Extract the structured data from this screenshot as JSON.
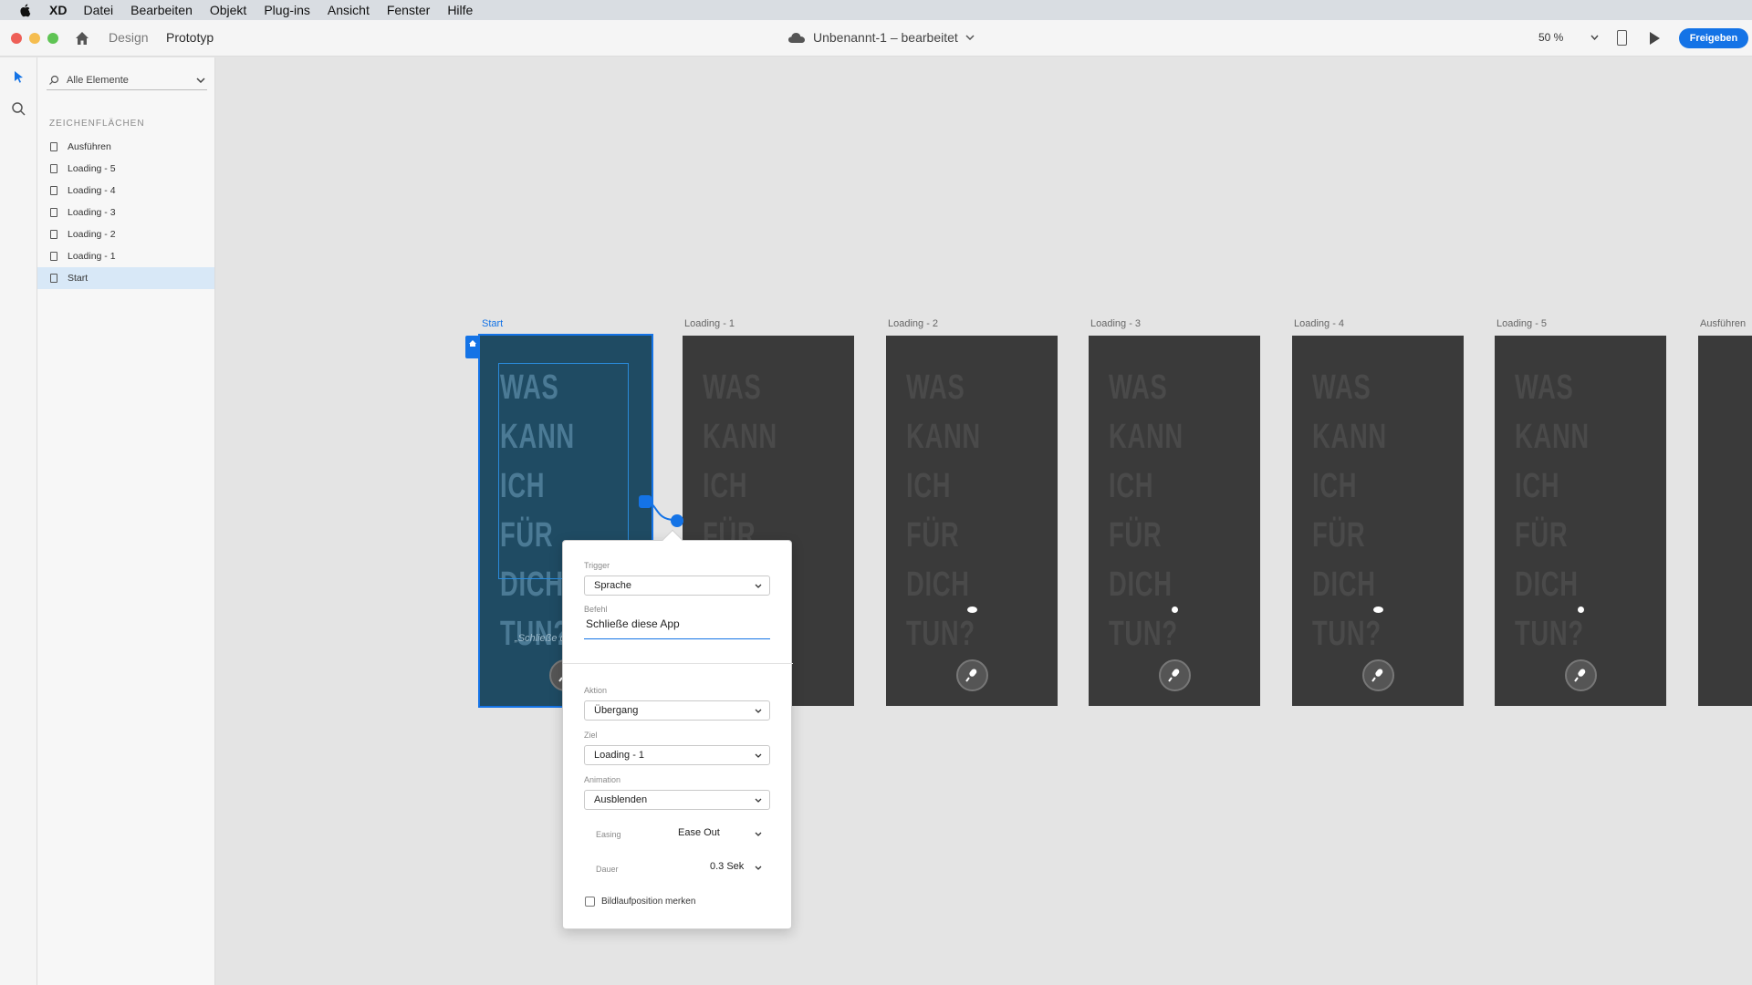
{
  "menubar": {
    "app": "XD",
    "items": [
      "Datei",
      "Bearbeiten",
      "Objekt",
      "Plug-ins",
      "Ansicht",
      "Fenster",
      "Hilfe"
    ]
  },
  "toolbar": {
    "tab_design": "Design",
    "tab_prototype": "Prototyp",
    "doc_title": "Unbenannt-1 – bearbeitet",
    "zoom": "50 %",
    "share": "Freigeben"
  },
  "layers": {
    "search_placeholder": "Alle Elemente",
    "section_title": "ZEICHENFLÄCHEN",
    "items": [
      "Ausführen",
      "Loading - 5",
      "Loading - 4",
      "Loading - 3",
      "Loading - 2",
      "Loading - 1",
      "Start"
    ],
    "selected": "Start"
  },
  "artboards": {
    "labels": [
      "Start",
      "Loading - 1",
      "Loading - 2",
      "Loading - 3",
      "Loading - 4",
      "Loading - 5",
      "Ausführen"
    ],
    "headline": "WAS\nKANN ICH\nFÜR DICH\nTUN?",
    "start_quote": "„Schließe d"
  },
  "interaction": {
    "trigger_label": "Trigger",
    "trigger_value": "Sprache",
    "command_label": "Befehl",
    "command_value": "Schließe diese App",
    "action_label": "Aktion",
    "action_value": "Übergang",
    "target_label": "Ziel",
    "target_value": "Loading - 1",
    "animation_label": "Animation",
    "animation_value": "Ausblenden",
    "easing_label": "Easing",
    "easing_value": "Ease Out",
    "duration_label": "Dauer",
    "duration_value": "0.3 Sek",
    "preserve_scroll_label": "Bildlaufposition merken"
  },
  "colors": {
    "accent": "#1473e6",
    "artboard": "#3a3a3a",
    "selected_artboard": "#1f4b63"
  }
}
